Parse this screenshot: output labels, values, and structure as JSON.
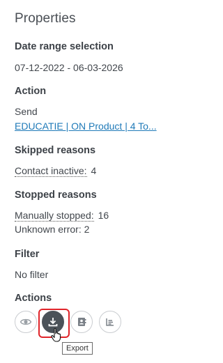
{
  "panel": {
    "title": "Properties",
    "date_range": {
      "heading": "Date range selection",
      "value": "07-12-2022 - 06-03-2026"
    },
    "action": {
      "heading": "Action",
      "type": "Send",
      "link": "EDUCATIE | ON Product | 4 To..."
    },
    "skipped": {
      "heading": "Skipped reasons",
      "items": [
        {
          "label": "Contact inactive:",
          "count": "4"
        }
      ]
    },
    "stopped": {
      "heading": "Stopped reasons",
      "items": [
        {
          "label": "Manually stopped:",
          "count": "16"
        },
        {
          "label": "Unknown error: 2"
        }
      ]
    },
    "filter": {
      "heading": "Filter",
      "value": "No filter"
    },
    "actions": {
      "heading": "Actions",
      "buttons": [
        {
          "icon": "eye-icon"
        },
        {
          "icon": "download-icon"
        },
        {
          "icon": "contact-card-icon"
        },
        {
          "icon": "report-list-icon"
        }
      ],
      "tooltip": "Export"
    }
  },
  "colors": {
    "link": "#1f7ab8",
    "highlight": "#e0242a",
    "active_button": "#4b5259"
  }
}
